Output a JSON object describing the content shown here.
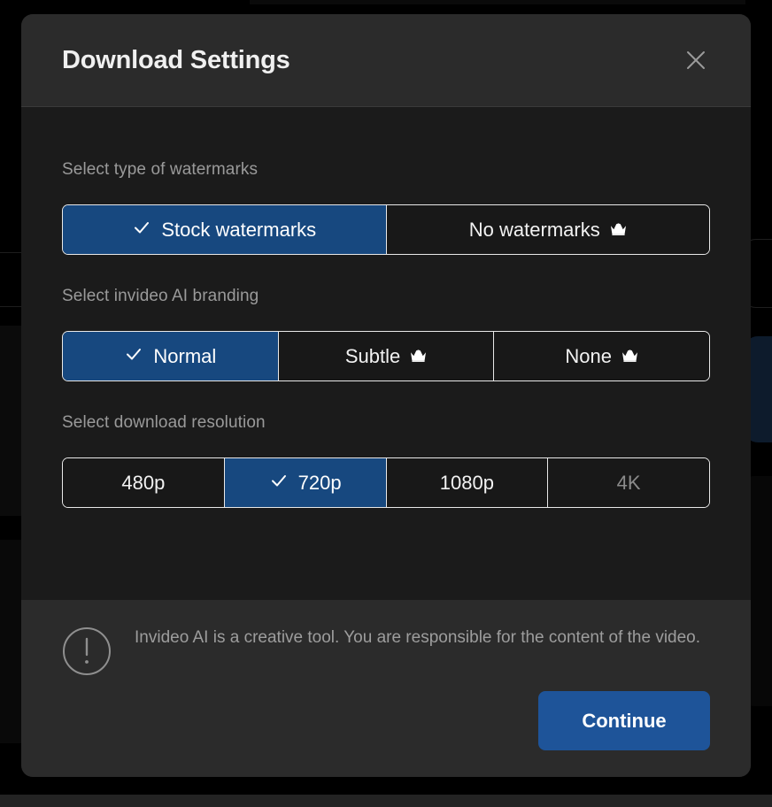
{
  "modal": {
    "title": "Download Settings",
    "close_icon": "close-icon"
  },
  "sections": [
    {
      "label": "Select type of watermarks",
      "options": [
        {
          "label": "Stock watermarks",
          "selected": true,
          "premium": false,
          "disabled": false
        },
        {
          "label": "No watermarks",
          "selected": false,
          "premium": true,
          "disabled": false
        }
      ]
    },
    {
      "label": "Select invideo AI branding",
      "options": [
        {
          "label": "Normal",
          "selected": true,
          "premium": false,
          "disabled": false
        },
        {
          "label": "Subtle",
          "selected": false,
          "premium": true,
          "disabled": false
        },
        {
          "label": "None",
          "selected": false,
          "premium": true,
          "disabled": false
        }
      ]
    },
    {
      "label": "Select download resolution",
      "options": [
        {
          "label": "480p",
          "selected": false,
          "premium": false,
          "disabled": false
        },
        {
          "label": "720p",
          "selected": true,
          "premium": false,
          "disabled": false
        },
        {
          "label": "1080p",
          "selected": false,
          "premium": false,
          "disabled": false
        },
        {
          "label": "4K",
          "selected": false,
          "premium": false,
          "disabled": true
        }
      ]
    }
  ],
  "footer": {
    "warning_icon": "exclamation-circle-icon",
    "disclaimer": "Invideo AI is a creative tool. You are responsible for the content of the video.",
    "continue_label": "Continue"
  },
  "colors": {
    "accent_selected": "#17487f",
    "accent_button": "#1e5499",
    "modal_body": "#1b1b1b",
    "modal_chrome": "#2b2b2b",
    "label_text": "#9a9a9a",
    "disabled_text": "#8b8b8b"
  }
}
